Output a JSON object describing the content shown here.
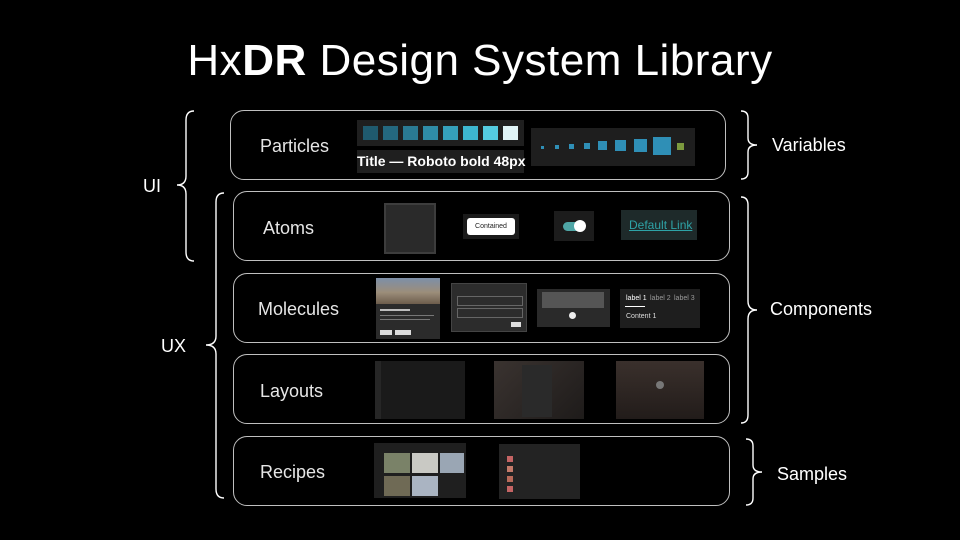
{
  "title": {
    "prefix": "Hx",
    "bold": "DR",
    "rest": " Design System Library"
  },
  "rows": [
    {
      "label": "Particles"
    },
    {
      "label": "Atoms"
    },
    {
      "label": "Molecules"
    },
    {
      "label": "Layouts"
    },
    {
      "label": "Recipes"
    }
  ],
  "groups": {
    "ui": "UI",
    "ux": "UX",
    "variables": "Variables",
    "components": "Components",
    "samples": "Samples"
  },
  "thumbnails": {
    "typography_sample": "Title — Roboto bold 48px",
    "atom_button": "Contained",
    "atom_link": "Default Link",
    "tabs": [
      "label 1",
      "label 2",
      "label 3"
    ],
    "tab_content": "Content 1"
  },
  "colors": {
    "background": "#000000",
    "border": "#bfbfbf",
    "accent": "#2ea3a7",
    "swatches": [
      "#1f5a6e",
      "#24687f",
      "#2a7a93",
      "#2f8ca7",
      "#35a0bb",
      "#3db6cf",
      "#54cbe0",
      "#dff3f6"
    ]
  }
}
